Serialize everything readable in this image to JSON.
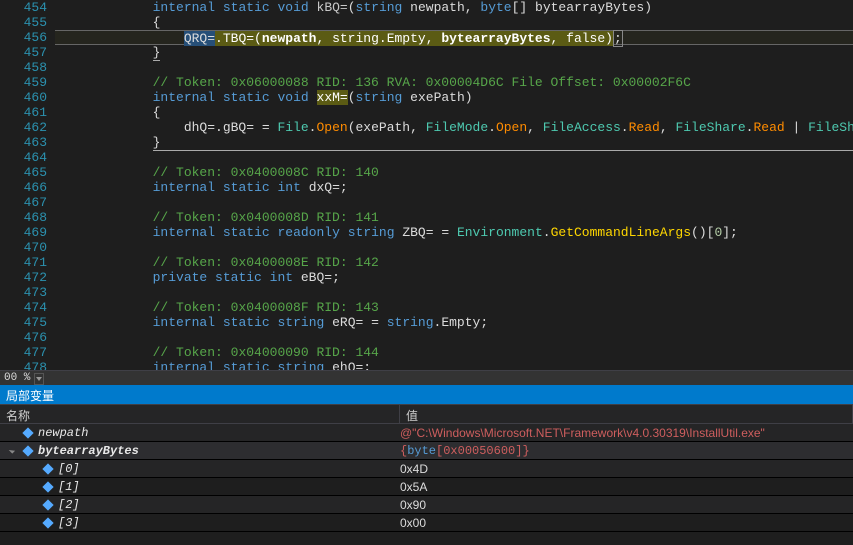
{
  "zoom": "00 %",
  "lineStart": 454,
  "lines": [
    {
      "n": 454,
      "html": "            <span class='kw1'>internal</span> <span class='kw1'>static</span> <span class='kw1'>void</span> <span class='fn'>kBQ=</span>(<span class='kw1'>string</span> <span class='nm'>newpath</span>, <span class='kw1'>byte</span>[] <span class='nm'>bytearrayBytes</span>)"
    },
    {
      "n": 455,
      "html": "            {"
    },
    {
      "n": 456,
      "hl": true,
      "html": "                <span class='hl-sel'>QRQ=</span><span class='hl-yel'>.TBQ=(<b>newpath</b>, </span><span class='hl-yel'>string</span><span class='hl-yel'>.Empty, <b>bytearrayBytes</b>, </span><span class='hl-yel'>false</span><span class='hl-yel'>)</span><span class='caret-box'>;</span>"
    },
    {
      "n": 457,
      "html": "            <span style='border-bottom:1px solid #aaa;'>}</span>"
    },
    {
      "n": 458,
      "html": ""
    },
    {
      "n": 459,
      "html": "            <span class='cmt'>// Token: 0x06000088 RID: 136 RVA: 0x00004D6C File Offset: 0x00002F6C</span>"
    },
    {
      "n": 460,
      "html": "            <span class='kw1'>internal</span> <span class='kw1'>static</span> <span class='kw1'>void</span> <span class='hl-yel'>xxM=</span>(<span class='kw1'>string</span> <span class='nm'>exePath</span>)"
    },
    {
      "n": 461,
      "html": "            {"
    },
    {
      "n": 462,
      "html": "                dhQ=.gBQ= = <span class='typ'>File</span>.<span class='warn'>Open</span>(<span class='nm'>exePath</span>, <span class='typ'>FileMode</span>.<span class='warn'>Open</span>, <span class='typ'>FileAccess</span>.<span class='warn'>Read</span>, <span class='typ'>FileShare</span>.<span class='warn'>Read</span> | <span class='typ'>FileShare</span>.<span class='warn'>Inheritabl</span>"
    },
    {
      "n": 463,
      "html": "            <span style='border-bottom:1px solid #aaa;display:inline-block;width:790px;'>}</span>"
    },
    {
      "n": 464,
      "html": ""
    },
    {
      "n": 465,
      "html": "            <span class='cmt'>// Token: 0x0400008C RID: 140</span>"
    },
    {
      "n": 466,
      "html": "            <span class='kw1'>internal</span> <span class='kw1'>static</span> <span class='kw1'>int</span> dxQ=;"
    },
    {
      "n": 467,
      "html": ""
    },
    {
      "n": 468,
      "html": "            <span class='cmt'>// Token: 0x0400008D RID: 141</span>"
    },
    {
      "n": 469,
      "html": "            <span class='kw1'>internal</span> <span class='kw1'>static</span> <span class='kw1'>readonly</span> <span class='kw1'>string</span> ZBQ= = <span class='typ'>Environment</span>.<span class='fnCall'>GetCommandLineArgs</span>()[<span class='num'>0</span>];"
    },
    {
      "n": 470,
      "html": ""
    },
    {
      "n": 471,
      "html": "            <span class='cmt'>// Token: 0x0400008E RID: 142</span>"
    },
    {
      "n": 472,
      "html": "            <span class='kw1'>private</span> <span class='kw1'>static</span> <span class='kw1'>int</span> eBQ=;"
    },
    {
      "n": 473,
      "html": ""
    },
    {
      "n": 474,
      "html": "            <span class='cmt'>// Token: 0x0400008F RID: 143</span>"
    },
    {
      "n": 475,
      "html": "            <span class='kw1'>internal</span> <span class='kw1'>static</span> <span class='kw1'>string</span> eRQ= = <span class='kw1'>string</span>.Empty;"
    },
    {
      "n": 476,
      "html": ""
    },
    {
      "n": 477,
      "html": "            <span class='cmt'>// Token: 0x04000090 RID: 144</span>"
    },
    {
      "n": 478,
      "html": "            <span class='kw1'>internal</span> <span class='kw1'>static</span> <span class='kw1'>string</span> ehQ=;"
    }
  ],
  "localsTitle": "局部变量",
  "colName": "名称",
  "colValue": "值",
  "vars": [
    {
      "depth": 0,
      "tw": "none",
      "name": "newpath",
      "val": "@\"C:\\Windows\\Microsoft.NET\\Framework\\v4.0.30319\\InstallUtil.exe\"",
      "cls": "val-red"
    },
    {
      "depth": 0,
      "tw": "open",
      "name": "bytearrayBytes",
      "bold": true,
      "val": "<span>{</span><span class='val-byte'>byte</span><span>[0x00050600]</span><span>}</span>",
      "cls": "val-red",
      "hl": true
    },
    {
      "depth": 1,
      "tw": "none",
      "name": "[0]",
      "val": "0x4D"
    },
    {
      "depth": 1,
      "tw": "none",
      "name": "[1]",
      "val": "0x5A"
    },
    {
      "depth": 1,
      "tw": "none",
      "name": "[2]",
      "val": "0x90"
    },
    {
      "depth": 1,
      "tw": "none",
      "name": "[3]",
      "val": "0x00"
    }
  ]
}
